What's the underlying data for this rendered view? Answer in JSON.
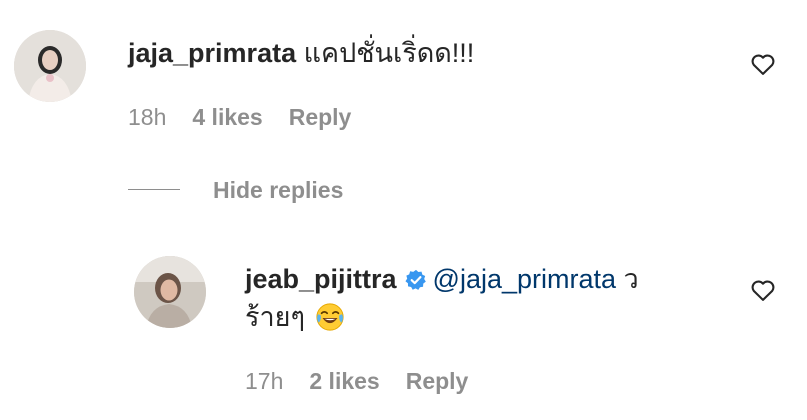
{
  "comment": {
    "username": "jaja_primrata",
    "text": "แคปชั่นเริ่ดด!!!",
    "time": "18h",
    "likes": "4 likes",
    "reply_label": "Reply",
    "avatar_icon": "user-avatar-icon",
    "like_icon": "heart-outline-icon"
  },
  "replies_toggle": {
    "label": "Hide replies"
  },
  "reply": {
    "username": "jeab_pijittra",
    "verified_icon": "verified-badge-icon",
    "mention": "@jaja_primrata",
    "text_line1": "ว",
    "text_line2": "ร้ายๆ",
    "emoji": "face-with-tears-of-joy-emoji",
    "time": "17h",
    "likes": "2 likes",
    "reply_label": "Reply",
    "avatar_icon": "user-avatar-icon",
    "like_icon": "heart-outline-icon"
  },
  "colors": {
    "text": "#262626",
    "meta": "#8e8e8e",
    "mention": "#00376b",
    "verified": "#3897f0"
  }
}
